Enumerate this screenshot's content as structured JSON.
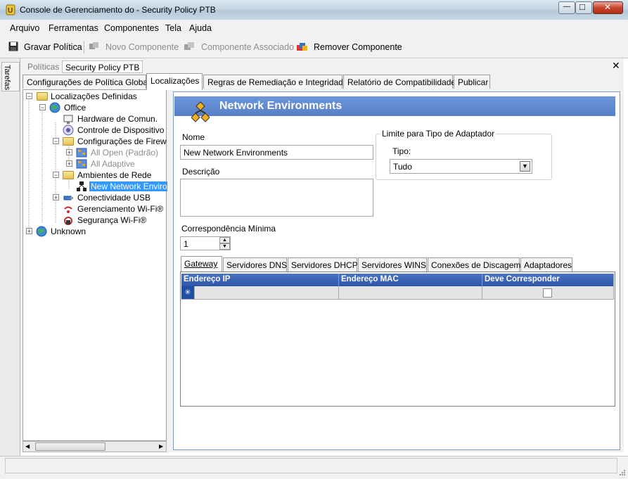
{
  "window": {
    "title": "Console de Gerenciamento do  - Security Policy PTB",
    "minimize_glyph": "—",
    "maximize_glyph": "□",
    "close_glyph": "✕"
  },
  "menu": [
    "Arquivo",
    "Ferramentas",
    "Componentes",
    "Tela",
    "Ajuda"
  ],
  "toolbar": {
    "save": "Gravar Política",
    "new_component": "Novo Componente",
    "associated_component": "Componente Associado",
    "remove_component": "Remover Componente"
  },
  "tasks_label": "Tarefas",
  "breadcrumb": {
    "policies": "Políticas",
    "current": "Security Policy PTB",
    "close": "✕"
  },
  "tabs": [
    "Configurações de Política Global",
    "Localizações",
    "Regras de Remediação e Integridade",
    "Relatório de Compatibilidade",
    "Publicar"
  ],
  "tree": {
    "root": "Localizações Definidas",
    "office": "Office",
    "hardware": "Hardware de Comun.",
    "device_control": "Controle de Dispositivo",
    "firewall": "Configurações de Firew",
    "all_open": "All Open (Padrão)",
    "all_adaptive": "All Adaptive",
    "network_envs": "Ambientes de Rede",
    "new_network": "New Network Enviro",
    "usb": "Conectividade USB",
    "wifi_mgmt": "Gerenciamento Wi-Fi®",
    "wifi_security": "Segurança Wi-Fi®",
    "unknown": "Unknown"
  },
  "content": {
    "title": "Network Environments",
    "name_label": "Nome",
    "name_value": "New Network Environments",
    "description_label": "Descrição",
    "description_value": "",
    "adapter_group_label": "Limite para Tipo de Adaptador",
    "type_label": "Tipo:",
    "type_value": "Tudo",
    "min_match_label": "Correspondência Mínima",
    "min_match_value": "1"
  },
  "subtabs": [
    "Gateway",
    "Servidores DNS",
    "Servidores DHCP",
    "Servidores WINS",
    "Conexões de Discagem",
    "Adaptadores"
  ],
  "grid": {
    "columns": [
      "Endereço IP",
      "Endereço MAC",
      "Deve Corresponder"
    ],
    "new_row_marker": "✳"
  }
}
